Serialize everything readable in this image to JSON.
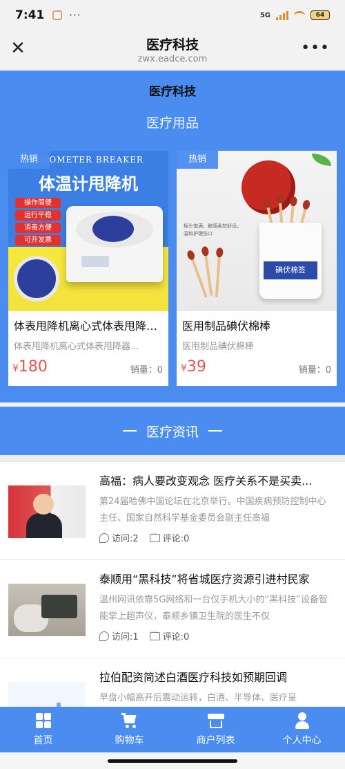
{
  "status_bar": {
    "time": "7:41",
    "network": "5G",
    "battery": "64"
  },
  "nav": {
    "close_glyph": "✕",
    "title": "医疗科技",
    "url": "zwx.eadce.com",
    "more_glyph": "•••"
  },
  "site_title": "医疗科技",
  "products_section": {
    "title": "医疗用品",
    "items": [
      {
        "badge": "热销",
        "image_banner": "RMOMETER BREAKER",
        "image_heading": "体温计甩降机",
        "image_tags": [
          "操作简便",
          "运行平稳",
          "消毒方便",
          "可开发票"
        ],
        "name": "体表甩降机离心式体表甩降器...",
        "desc": "体表甩降机离心式体表甩降器...",
        "currency": "¥",
        "price": "180",
        "sales": "销量：0"
      },
      {
        "badge": "热销",
        "image_note": "棉头饱满，触感柔软舒适，温和护理伤口",
        "image_label": "碘伏棉签",
        "name": "医用制品碘伏棉棒",
        "desc": "医用制品碘伏棉棒",
        "currency": "¥",
        "price": "39",
        "sales": "销量：0"
      }
    ]
  },
  "news_section": {
    "title": "医疗资讯",
    "items": [
      {
        "title": "高福：病人要改变观念 医疗关系不是买卖...",
        "summary": "第24届哈佛中国论坛在北京举行。中国疾病预防控制中心主任、国家自然科学基金委员会副主任高福",
        "visits": "访问:2",
        "comments": "评论:0"
      },
      {
        "title": "泰顺用“黑科技”将省城医疗资源引进村民家",
        "summary": "温州网讯依靠5G网络和一台仅手机大小的“黑科技”设备智能掌上超声仪，泰顺乡镇卫生院的医生不仅",
        "visits": "访问:1",
        "comments": "评论:0"
      },
      {
        "title": "拉伯配资简述白酒医疗科技如预期回调",
        "summary": "早盘小幅高开后震动运转，白酒、半导体、医疗呈",
        "visits": "",
        "comments": ""
      }
    ]
  },
  "tabbar": {
    "items": [
      {
        "label": "首页",
        "icon": "home-grid-icon"
      },
      {
        "label": "购物车",
        "icon": "cart-icon"
      },
      {
        "label": "商户列表",
        "icon": "shop-icon"
      },
      {
        "label": "个人中心",
        "icon": "user-icon"
      }
    ]
  },
  "colors": {
    "primary": "#4a8cf0",
    "price": "#e8554e",
    "badge": "#4a8cf0"
  }
}
